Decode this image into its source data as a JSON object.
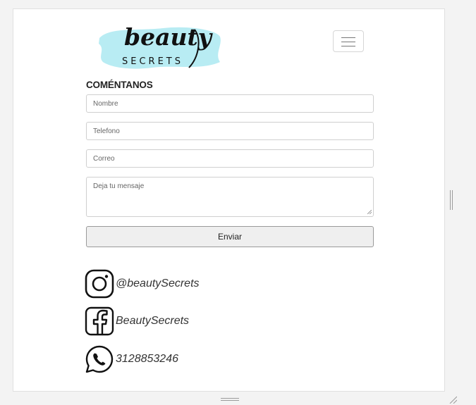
{
  "logo": {
    "word": "beauty",
    "sub": "SECRETS"
  },
  "menu": {
    "icon": "hamburger-icon"
  },
  "form": {
    "title": "COMÉNTANOS",
    "name_placeholder": "Nombre",
    "phone_placeholder": "Telefono",
    "email_placeholder": "Correo",
    "message_placeholder": "Deja tu mensaje",
    "submit_label": "Enviar"
  },
  "social": {
    "instagram": {
      "icon": "instagram-icon",
      "label": "@beautySecrets"
    },
    "facebook": {
      "icon": "facebook-icon",
      "label": "BeautySecrets"
    },
    "whatsapp": {
      "icon": "whatsapp-icon",
      "label": "3128853246"
    }
  },
  "colors": {
    "logo_splash": "#b8ecf3",
    "text": "#222222",
    "button_bg": "#efefef",
    "border": "#cfcfcf"
  }
}
